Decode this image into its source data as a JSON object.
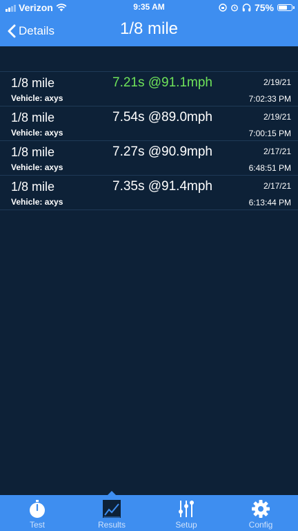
{
  "status_bar": {
    "carrier": "Verizon",
    "time": "9:35 AM",
    "battery": "75%",
    "battery_level": 0.75
  },
  "nav": {
    "back_label": "Details",
    "title": "1/8 mile"
  },
  "runs": [
    {
      "distance": "1/8 mile",
      "vehicle": "Vehicle: axys",
      "result": "7.21s @91.1mph",
      "date": "2/19/21",
      "time": "7:02:33 PM",
      "highlight": true
    },
    {
      "distance": "1/8 mile",
      "vehicle": "Vehicle: axys",
      "result": "7.54s @89.0mph",
      "date": "2/19/21",
      "time": "7:00:15 PM",
      "highlight": false
    },
    {
      "distance": "1/8 mile",
      "vehicle": "Vehicle: axys",
      "result": "7.27s @90.9mph",
      "date": "2/17/21",
      "time": "6:48:51 PM",
      "highlight": false
    },
    {
      "distance": "1/8 mile",
      "vehicle": "Vehicle: axys",
      "result": "7.35s @91.4mph",
      "date": "2/17/21",
      "time": "6:13:44 PM",
      "highlight": false
    }
  ],
  "tabs": [
    {
      "label": "Test",
      "icon": "stopwatch-icon"
    },
    {
      "label": "Results",
      "icon": "chart-icon",
      "selected": true
    },
    {
      "label": "Setup",
      "icon": "sliders-icon"
    },
    {
      "label": "Config",
      "icon": "gear-icon"
    }
  ],
  "colors": {
    "accent": "#3e8ef0",
    "background": "#0d2137",
    "best_result": "#6fe35a"
  }
}
